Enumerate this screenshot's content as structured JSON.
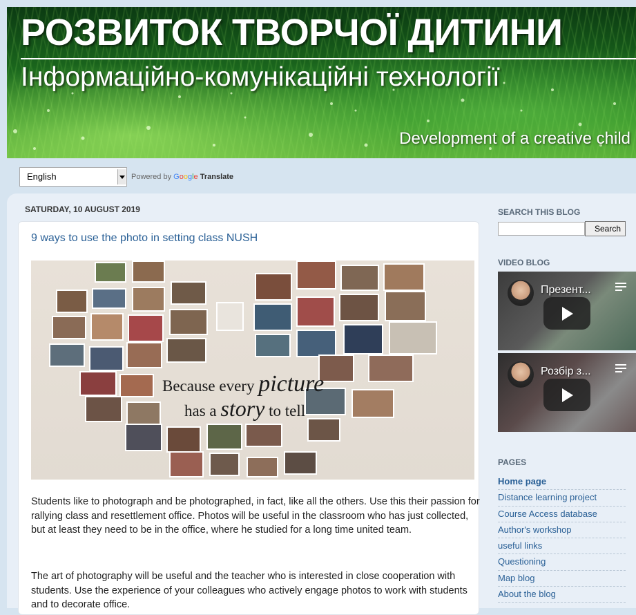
{
  "header": {
    "title": "РОЗВИТОК ТВОРЧОЇ ДИТИНИ",
    "subtitle": "Інформаційно-комунікаційні технології",
    "tagline": "Development of a creative child"
  },
  "translate": {
    "selected_language": "English",
    "powered_by": "Powered by",
    "google_letters": [
      "G",
      "o",
      "o",
      "g",
      "l",
      "e"
    ],
    "translate_word": "Translate"
  },
  "post": {
    "date": "Saturday, 10 August 2019",
    "title": "9 ways to use the photo in setting class NUSH",
    "image_quote": {
      "line1_a": "Because every",
      "line1_b": "picture",
      "line2_a": "has a",
      "line2_b": "story",
      "line2_c": "to tell"
    },
    "paragraphs": [
      "Students like to photograph and be photographed, in fact, like all the others. Use this their passion for rallying class and resettlement office. Photos will be useful in the classroom who has just collected, but at least they need to be in the office, where he studied for a long time united team.",
      "The art of photography will be useful and the teacher who is interested in close cooperation with students. Use the experience of your colleagues who actively engage photos to work with students and to decorate office."
    ]
  },
  "sidebar": {
    "search": {
      "heading": "Search This Blog",
      "button_label": "Search",
      "value": ""
    },
    "video_blog": {
      "heading": "Video Blog",
      "videos": [
        {
          "title": "Презент..."
        },
        {
          "title": "Розбір з..."
        }
      ]
    },
    "pages": {
      "heading": "Pages",
      "items": [
        {
          "label": "Home page"
        },
        {
          "label": "Distance learning project"
        },
        {
          "label": "Course Access database"
        },
        {
          "label": "Author's workshop"
        },
        {
          "label": "useful links"
        },
        {
          "label": "Questioning"
        },
        {
          "label": "Map blog"
        },
        {
          "label": "About the blog"
        }
      ]
    }
  },
  "colors": {
    "link": "#2a6096",
    "background": "#d6e4f0",
    "content_panel": "#e8eff7"
  }
}
